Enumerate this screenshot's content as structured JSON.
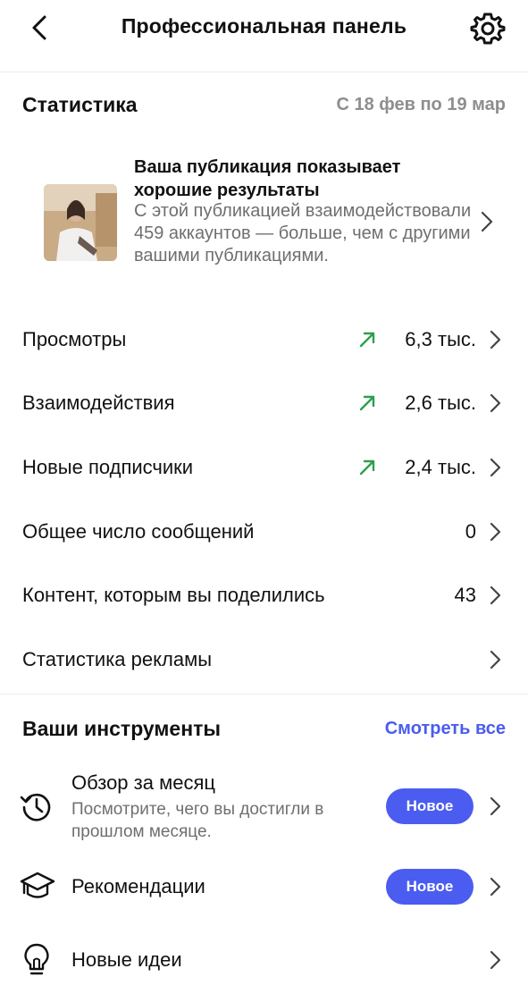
{
  "header": {
    "title": "Профессиональная панель",
    "back_icon": "chevron-left-icon",
    "settings_icon": "gear-icon"
  },
  "stats": {
    "title": "Статистика",
    "date_range": "С 18 фев по 19 мар",
    "highlight": {
      "title": "Ваша публикация показывает хорошие результаты",
      "text": "С этой публикацией взаимодействовали 459 аккаунтов — больше, чем с другими вашими публикациями."
    },
    "rows": [
      {
        "label": "Просмотры",
        "value": "6,3 тыс.",
        "trend": "up"
      },
      {
        "label": "Взаимодействия",
        "value": "2,6 тыс.",
        "trend": "up"
      },
      {
        "label": "Новые подписчики",
        "value": "2,4 тыс.",
        "trend": "up"
      },
      {
        "label": "Общее число сообщений",
        "value": "0"
      },
      {
        "label": "Контент, которым вы поделились",
        "value": "43"
      },
      {
        "label": "Статистика рекламы",
        "value": ""
      }
    ]
  },
  "tools": {
    "title": "Ваши инструменты",
    "see_all": "Смотреть все",
    "items": [
      {
        "name": "Обзор за месяц",
        "subtitle": "Посмотрите, чего вы достигли в прошлом месяце.",
        "badge": "Новое",
        "icon": "history-icon"
      },
      {
        "name": "Рекомендации",
        "badge": "Новое",
        "icon": "graduation-cap-icon"
      },
      {
        "name": "Новые идеи",
        "icon": "lightbulb-icon"
      }
    ]
  },
  "colors": {
    "accent": "#4b5cf0",
    "trend_up": "#2e9e4f",
    "muted": "#8e8e8e"
  }
}
